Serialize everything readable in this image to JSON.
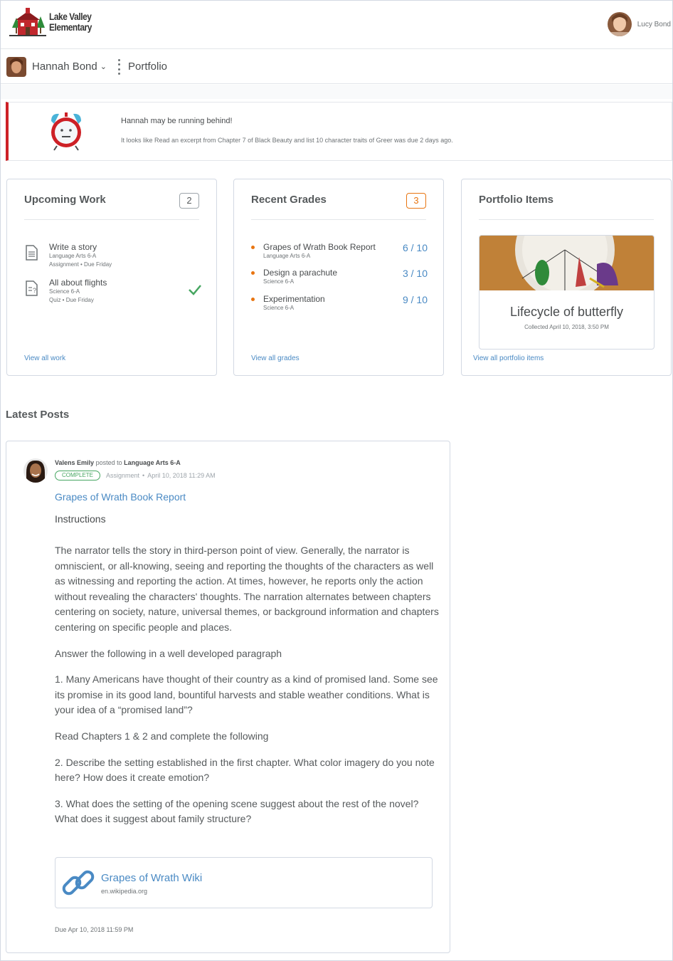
{
  "school": {
    "line1": "Lake Valley",
    "line2": "Elementary"
  },
  "user": {
    "name": "Lucy Bond"
  },
  "nav": {
    "student_name": "Hannah Bond",
    "section": "Portfolio"
  },
  "alert": {
    "title": "Hannah may be running behind!",
    "body": "It looks like Read an excerpt from Chapter 7 of Black Beauty and list 10 character traits of Greer was due 2 days ago."
  },
  "upcoming": {
    "title": "Upcoming Work",
    "count": "2",
    "items": [
      {
        "title": "Write a story",
        "course": "Language Arts 6-A",
        "meta": "Assignment • Due Friday",
        "icon": "assignment-icon",
        "done": false
      },
      {
        "title": "All about flights",
        "course": "Science 6-A",
        "meta": "Quiz • Due Friday",
        "icon": "quiz-icon",
        "done": true
      }
    ],
    "link": "View all work"
  },
  "grades": {
    "title": "Recent Grades",
    "count": "3",
    "items": [
      {
        "title": "Grapes of Wrath Book Report",
        "course": "Language Arts 6-A",
        "score": "6 / 10"
      },
      {
        "title": "Design a parachute",
        "course": "Science 6-A",
        "score": "3 / 10"
      },
      {
        "title": "Experimentation",
        "course": "Science 6-A",
        "score": "9 / 10"
      }
    ],
    "link": "View all grades"
  },
  "portfolio": {
    "title": "Portfolio Items",
    "item_title": "Lifecycle of butterfly",
    "item_sub": "Collected April 10, 2018, 3:50 PM",
    "link": "View all portfolio items"
  },
  "latest_posts": {
    "heading": "Latest Posts",
    "post": {
      "author": "Valens Emily",
      "posted_to": "posted to",
      "course": "Language Arts 6-A",
      "status": "COMPLETE",
      "type": "Assignment",
      "date": "April 10, 2018 11:29 AM",
      "title": "Grapes of Wrath Book Report",
      "instructions_label": "Instructions",
      "paragraphs": [
        "The narrator tells the story in third-person point of view. Generally, the narrator is omniscient, or all-knowing, seeing and reporting the thoughts of the characters as well as witnessing and reporting the action. At times, however, he reports only the action without revealing the characters' thoughts. The narration alternates between chapters centering on society, nature, universal themes, or background information and chapters centering on specific people and places.",
        "Answer the following in a well developed paragraph",
        "1. Many Americans have thought of their country as a kind of promised land. Some see its promise in its good land, bountiful harvests and stable weather conditions. What is your idea of a “promised land”?",
        "Read Chapters 1 & 2 and complete the following",
        "2. Describe the setting established in the first chapter. What color imagery do you note here? How does it create emotion?",
        "3. What does the setting of the opening scene suggest about the rest of the novel? What does it suggest about family structure?"
      ],
      "link_title": "Grapes of Wrath Wiki",
      "link_url": "en.wikipedia.org",
      "due": "Due Apr 10, 2018 11:59 PM"
    }
  },
  "colors": {
    "link": "#4a8ac4",
    "alert_bar": "#cd2026",
    "orange": "#e87511",
    "complete": "#46a661"
  }
}
